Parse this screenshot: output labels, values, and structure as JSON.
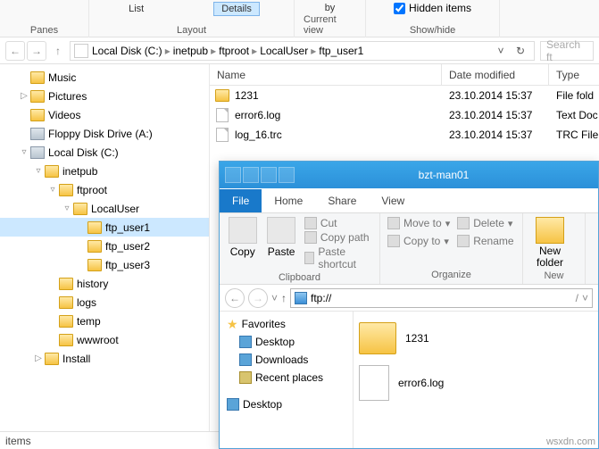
{
  "ribbon": {
    "panes": "Panes",
    "layout": "Layout",
    "current_view": "Current view",
    "showhide": "Show/hide",
    "list": "List",
    "details": "Details",
    "hidden_items": "Hidden items",
    "sort_label": "by"
  },
  "breadcrumbs": [
    "Local Disk (C:)",
    "inetpub",
    "ftproot",
    "LocalUser",
    "ftp_user1"
  ],
  "search_placeholder": "Search ft",
  "tree": [
    {
      "label": "Music",
      "indent": 1,
      "icon": "folder",
      "exp": ""
    },
    {
      "label": "Pictures",
      "indent": 1,
      "icon": "folder",
      "exp": "▷"
    },
    {
      "label": "Videos",
      "indent": 1,
      "icon": "folder",
      "exp": ""
    },
    {
      "label": "Floppy Disk Drive (A:)",
      "indent": 1,
      "icon": "drive",
      "exp": ""
    },
    {
      "label": "Local Disk (C:)",
      "indent": 1,
      "icon": "drive",
      "exp": "▿"
    },
    {
      "label": "inetpub",
      "indent": 2,
      "icon": "folder",
      "exp": "▿"
    },
    {
      "label": "ftproot",
      "indent": 3,
      "icon": "folder",
      "exp": "▿"
    },
    {
      "label": "LocalUser",
      "indent": 4,
      "icon": "folder",
      "exp": "▿"
    },
    {
      "label": "ftp_user1",
      "indent": 5,
      "icon": "folder",
      "exp": "",
      "sel": true
    },
    {
      "label": "ftp_user2",
      "indent": 5,
      "icon": "folder",
      "exp": ""
    },
    {
      "label": "ftp_user3",
      "indent": 5,
      "icon": "folder",
      "exp": ""
    },
    {
      "label": "history",
      "indent": 3,
      "icon": "folder",
      "exp": ""
    },
    {
      "label": "logs",
      "indent": 3,
      "icon": "folder",
      "exp": ""
    },
    {
      "label": "temp",
      "indent": 3,
      "icon": "folder",
      "exp": ""
    },
    {
      "label": "wwwroot",
      "indent": 3,
      "icon": "folder",
      "exp": ""
    },
    {
      "label": "Install",
      "indent": 2,
      "icon": "folder",
      "exp": "▷"
    }
  ],
  "columns": {
    "name": "Name",
    "date": "Date modified",
    "type": "Type"
  },
  "files": [
    {
      "name": "1231",
      "date": "23.10.2014 15:37",
      "type": "File fold",
      "icon": "folder"
    },
    {
      "name": "error6.log",
      "date": "23.10.2014 15:37",
      "type": "Text Doc",
      "icon": "file"
    },
    {
      "name": "log_16.trc",
      "date": "23.10.2014 15:37",
      "type": "TRC File",
      "icon": "file"
    }
  ],
  "status": "items",
  "win2": {
    "title": "bzt-man01",
    "tabs": {
      "file": "File",
      "home": "Home",
      "share": "Share",
      "view": "View"
    },
    "clipboard": {
      "copy": "Copy",
      "paste": "Paste",
      "cut": "Cut",
      "copy_path": "Copy path",
      "paste_shortcut": "Paste shortcut",
      "label": "Clipboard"
    },
    "organize": {
      "moveto": "Move to",
      "copyto": "Copy to",
      "del": "Delete",
      "rename": "Rename",
      "label": "Organize"
    },
    "new": {
      "newfolder": "New\nfolder",
      "label": "New"
    },
    "addr": "ftp://",
    "addr_caret": "/",
    "favorites": {
      "title": "Favorites",
      "items": [
        "Desktop",
        "Downloads",
        "Recent places"
      ],
      "desktop": "Desktop"
    },
    "tiles": [
      "1231",
      "error6.log"
    ]
  },
  "watermark": "wsxdn.com"
}
